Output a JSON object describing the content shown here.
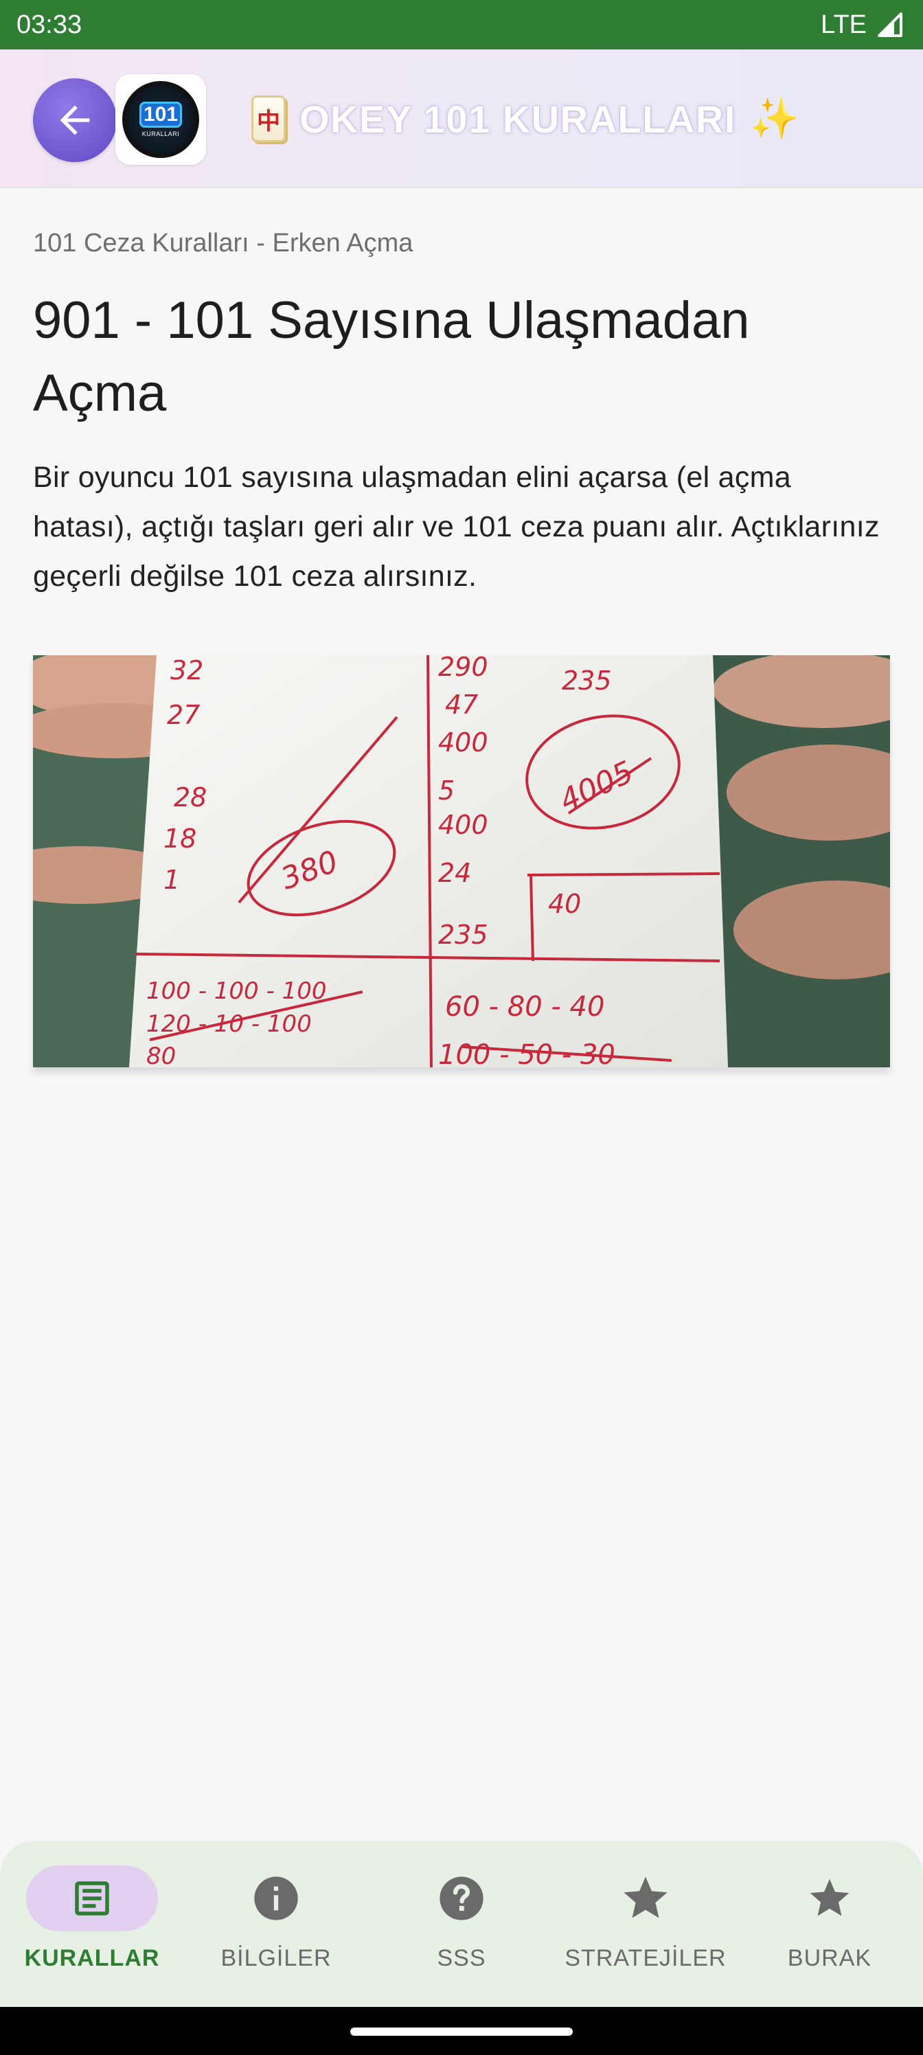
{
  "status_bar": {
    "time": "03:33",
    "network": "LTE"
  },
  "app_bar": {
    "title": "OKEY 101 KURALLARI",
    "title_icon": "mahjong-tile-icon",
    "trailing_icon": "sparkles-icon",
    "logo_number": "101",
    "logo_subtext": "KURALLARI"
  },
  "content": {
    "breadcrumb": "101 Ceza Kuralları - Erken Açma",
    "title": "901 - 101 Sayısına Ulaşmadan Açma",
    "body": "Bir oyuncu 101 sayısına ulaşmadan elini açarsa (el açma hatası), açtığı taşları geri alır ve 101 ceza puanı alır. Açtıklarınız geçerli değilse 101 ceza alırsınız."
  },
  "photo_notes": {
    "left_column": [
      "32",
      "27",
      "28",
      "18",
      "1"
    ],
    "circled_left": "380",
    "middle_column": [
      "290",
      "47",
      "400",
      "5",
      "400",
      "24",
      "235"
    ],
    "right_top": "235",
    "circled_right": "4005",
    "right_mid": "40",
    "bottom_left_rows": [
      "100 - 100 - 100",
      "120 - 10 - 100",
      "80"
    ],
    "bottom_right_rows": [
      "60 - 80 - 40",
      "100 - 50 - 30"
    ]
  },
  "bottom_nav": {
    "items": [
      {
        "label": "KURALLAR",
        "icon": "article-icon",
        "active": true
      },
      {
        "label": "BİLGİLER",
        "icon": "info-icon",
        "active": false
      },
      {
        "label": "SSS",
        "icon": "help-icon",
        "active": false
      },
      {
        "label": "STRATEJİLER",
        "icon": "star-icon",
        "active": false
      },
      {
        "label": "BURAK",
        "icon": "star-icon",
        "active": false
      }
    ]
  },
  "colors": {
    "status_bar": "#2e7d32",
    "back_button": "#6e57cf",
    "active_nav": "#2e7d32",
    "active_pill": "#e2d0f0",
    "nav_background": "#e6f1e4",
    "ink": "#c8283c"
  }
}
